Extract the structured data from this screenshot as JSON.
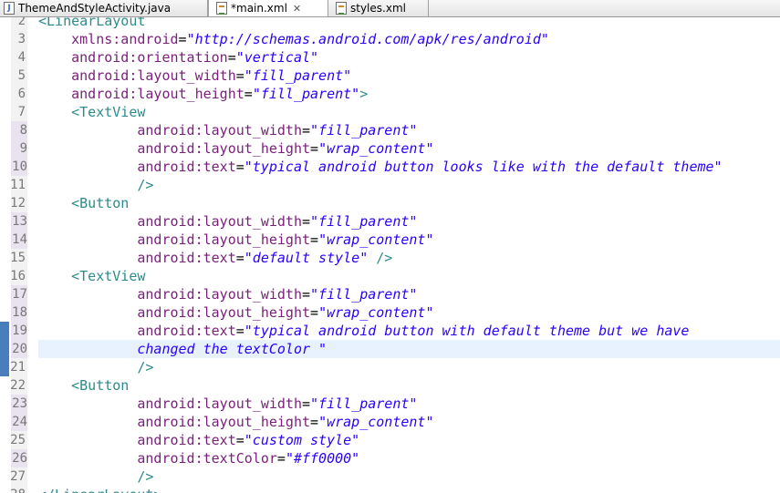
{
  "tabs": [
    {
      "label": "ThemeAndStyleActivity.java",
      "icon": "java-file-icon",
      "active": false
    },
    {
      "label": "*main.xml",
      "icon": "xml-file-icon",
      "active": true,
      "close": "✕"
    },
    {
      "label": "styles.xml",
      "icon": "xml-file-icon",
      "active": false
    }
  ],
  "lines": [
    {
      "n": "2",
      "indent": "",
      "parts": [
        {
          "t": "<LinearLayout",
          "c": "tag"
        }
      ]
    },
    {
      "n": "3",
      "indent": "    ",
      "parts": [
        {
          "t": "xmlns:android",
          "c": "attr"
        },
        {
          "t": "=",
          "c": "plain"
        },
        {
          "t": "\"http://schemas.android.com/apk/res/android\"",
          "c": "val"
        }
      ]
    },
    {
      "n": "4",
      "indent": "    ",
      "parts": [
        {
          "t": "android:orientation",
          "c": "attr"
        },
        {
          "t": "=",
          "c": "plain"
        },
        {
          "t": "\"vertical\"",
          "c": "val"
        }
      ]
    },
    {
      "n": "5",
      "indent": "    ",
      "parts": [
        {
          "t": "android:layout_width",
          "c": "attr"
        },
        {
          "t": "=",
          "c": "plain"
        },
        {
          "t": "\"fill_parent\"",
          "c": "val"
        }
      ]
    },
    {
      "n": "6",
      "indent": "    ",
      "parts": [
        {
          "t": "android:layout_height",
          "c": "attr"
        },
        {
          "t": "=",
          "c": "plain"
        },
        {
          "t": "\"fill_parent\"",
          "c": "val"
        },
        {
          "t": ">",
          "c": "tag"
        }
      ]
    },
    {
      "n": "7",
      "indent": "    ",
      "parts": [
        {
          "t": "<TextView",
          "c": "tag"
        }
      ]
    },
    {
      "n": "8",
      "indent": "            ",
      "mod": true,
      "parts": [
        {
          "t": "android:layout_width",
          "c": "attr"
        },
        {
          "t": "=",
          "c": "plain"
        },
        {
          "t": "\"fill_parent\"",
          "c": "val"
        }
      ]
    },
    {
      "n": "9",
      "indent": "            ",
      "mod": true,
      "parts": [
        {
          "t": "android:layout_height",
          "c": "attr"
        },
        {
          "t": "=",
          "c": "plain"
        },
        {
          "t": "\"wrap_content\"",
          "c": "val"
        }
      ]
    },
    {
      "n": "10",
      "indent": "            ",
      "mod": true,
      "parts": [
        {
          "t": "android:text",
          "c": "attr"
        },
        {
          "t": "=",
          "c": "plain"
        },
        {
          "t": "\"typical android button looks like with the default theme\"",
          "c": "val"
        }
      ]
    },
    {
      "n": "11",
      "indent": "            ",
      "parts": [
        {
          "t": "/>",
          "c": "tag"
        }
      ]
    },
    {
      "n": "12",
      "indent": "    ",
      "parts": [
        {
          "t": "<Button",
          "c": "tag"
        }
      ]
    },
    {
      "n": "13",
      "indent": "            ",
      "mod": true,
      "parts": [
        {
          "t": "android:layout_width",
          "c": "attr"
        },
        {
          "t": "=",
          "c": "plain"
        },
        {
          "t": "\"fill_parent\"",
          "c": "val"
        }
      ]
    },
    {
      "n": "14",
      "indent": "            ",
      "mod": true,
      "parts": [
        {
          "t": "android:layout_height",
          "c": "attr"
        },
        {
          "t": "=",
          "c": "plain"
        },
        {
          "t": "\"wrap_content\"",
          "c": "val"
        }
      ]
    },
    {
      "n": "15",
      "indent": "            ",
      "parts": [
        {
          "t": "android:text",
          "c": "attr"
        },
        {
          "t": "=",
          "c": "plain"
        },
        {
          "t": "\"default style\"",
          "c": "val"
        },
        {
          "t": " />",
          "c": "tag"
        }
      ]
    },
    {
      "n": "16",
      "indent": "    ",
      "parts": [
        {
          "t": "<TextView",
          "c": "tag"
        }
      ]
    },
    {
      "n": "17",
      "indent": "            ",
      "mod": true,
      "parts": [
        {
          "t": "android:layout_width",
          "c": "attr"
        },
        {
          "t": "=",
          "c": "plain"
        },
        {
          "t": "\"fill_parent\"",
          "c": "val"
        }
      ]
    },
    {
      "n": "18",
      "indent": "            ",
      "mod": true,
      "parts": [
        {
          "t": "android:layout_height",
          "c": "attr"
        },
        {
          "t": "=",
          "c": "plain"
        },
        {
          "t": "\"wrap_content\"",
          "c": "val"
        }
      ]
    },
    {
      "n": "19",
      "indent": "            ",
      "mod": true,
      "change": true,
      "parts": [
        {
          "t": "android:text",
          "c": "attr"
        },
        {
          "t": "=",
          "c": "plain"
        },
        {
          "t": "\"typical android button with default theme but we have",
          "c": "val"
        }
      ]
    },
    {
      "n": "20",
      "indent": "            ",
      "mod": true,
      "change": true,
      "current": true,
      "parts": [
        {
          "t": "changed the textColor \"",
          "c": "val"
        }
      ]
    },
    {
      "n": "21",
      "indent": "            ",
      "change": true,
      "parts": [
        {
          "t": "/>",
          "c": "tag"
        }
      ]
    },
    {
      "n": "22",
      "indent": "    ",
      "parts": [
        {
          "t": "<Button",
          "c": "tag"
        }
      ]
    },
    {
      "n": "23",
      "indent": "            ",
      "mod": true,
      "parts": [
        {
          "t": "android:layout_width",
          "c": "attr"
        },
        {
          "t": "=",
          "c": "plain"
        },
        {
          "t": "\"fill_parent\"",
          "c": "val"
        }
      ]
    },
    {
      "n": "24",
      "indent": "            ",
      "mod": true,
      "parts": [
        {
          "t": "android:layout_height",
          "c": "attr"
        },
        {
          "t": "=",
          "c": "plain"
        },
        {
          "t": "\"wrap_content\"",
          "c": "val"
        }
      ]
    },
    {
      "n": "25",
      "indent": "            ",
      "parts": [
        {
          "t": "android:text",
          "c": "attr"
        },
        {
          "t": "=",
          "c": "plain"
        },
        {
          "t": "\"custom style\"",
          "c": "val"
        }
      ]
    },
    {
      "n": "26",
      "indent": "            ",
      "mod": true,
      "parts": [
        {
          "t": "android:textColor",
          "c": "attr"
        },
        {
          "t": "=",
          "c": "plain"
        },
        {
          "t": "\"#ff0000\"",
          "c": "val"
        }
      ]
    },
    {
      "n": "27",
      "indent": "            ",
      "parts": [
        {
          "t": "/>",
          "c": "tag"
        }
      ]
    },
    {
      "n": "28",
      "indent": "",
      "parts": [
        {
          "t": "</LinearLayout>",
          "c": "tag"
        }
      ]
    }
  ],
  "colors": {
    "tag": "#2e8b8b",
    "attribute": "#7a1f7a",
    "value": "#2a00ff",
    "current_line": "#e8f2fe",
    "change_marker": "#4a7dbb"
  }
}
